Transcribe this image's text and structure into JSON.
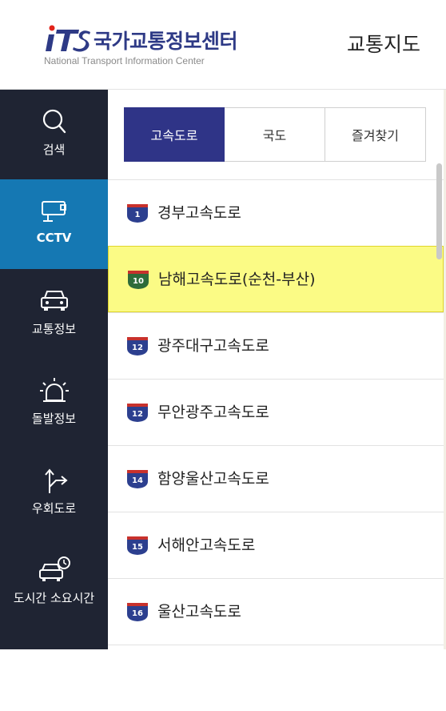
{
  "header": {
    "logo_ko": "국가교통정보센터",
    "logo_en": "National Transport Information Center",
    "title": "교통지도"
  },
  "nav": [
    {
      "label": "검색",
      "icon": "search-icon"
    },
    {
      "label": "CCTV",
      "icon": "cctv-icon"
    },
    {
      "label": "교통정보",
      "icon": "car-icon"
    },
    {
      "label": "돌발정보",
      "icon": "alert-siren-icon"
    },
    {
      "label": "우회도로",
      "icon": "detour-arrow-icon"
    },
    {
      "label": "도시간 소요시간",
      "icon": "car-clock-icon"
    }
  ],
  "active_nav": "CCTV",
  "tabs": [
    {
      "label": "고속도로"
    },
    {
      "label": "국도"
    },
    {
      "label": "즐겨찾기"
    }
  ],
  "active_tab": "고속도로",
  "roads": [
    {
      "num": "1",
      "name": "경부고속도로",
      "shield": "blue"
    },
    {
      "num": "10",
      "name": "남해고속도로(순천-부산)",
      "shield": "green"
    },
    {
      "num": "12",
      "name": "광주대구고속도로",
      "shield": "blue"
    },
    {
      "num": "12",
      "name": "무안광주고속도로",
      "shield": "blue"
    },
    {
      "num": "14",
      "name": "함양울산고속도로",
      "shield": "blue"
    },
    {
      "num": "15",
      "name": "서해안고속도로",
      "shield": "blue"
    },
    {
      "num": "16",
      "name": "울산고속도로",
      "shield": "blue"
    }
  ],
  "highlighted_road": "남해고속도로(순천-부산)",
  "colors": {
    "nav_bg": "#1f2433",
    "nav_active": "#1578b3",
    "tab_active": "#2f3487",
    "highlight": "#fbfb85",
    "shield_blue": "#2c3f8f",
    "shield_green": "#2e6b3a",
    "shield_red": "#c8312c"
  }
}
